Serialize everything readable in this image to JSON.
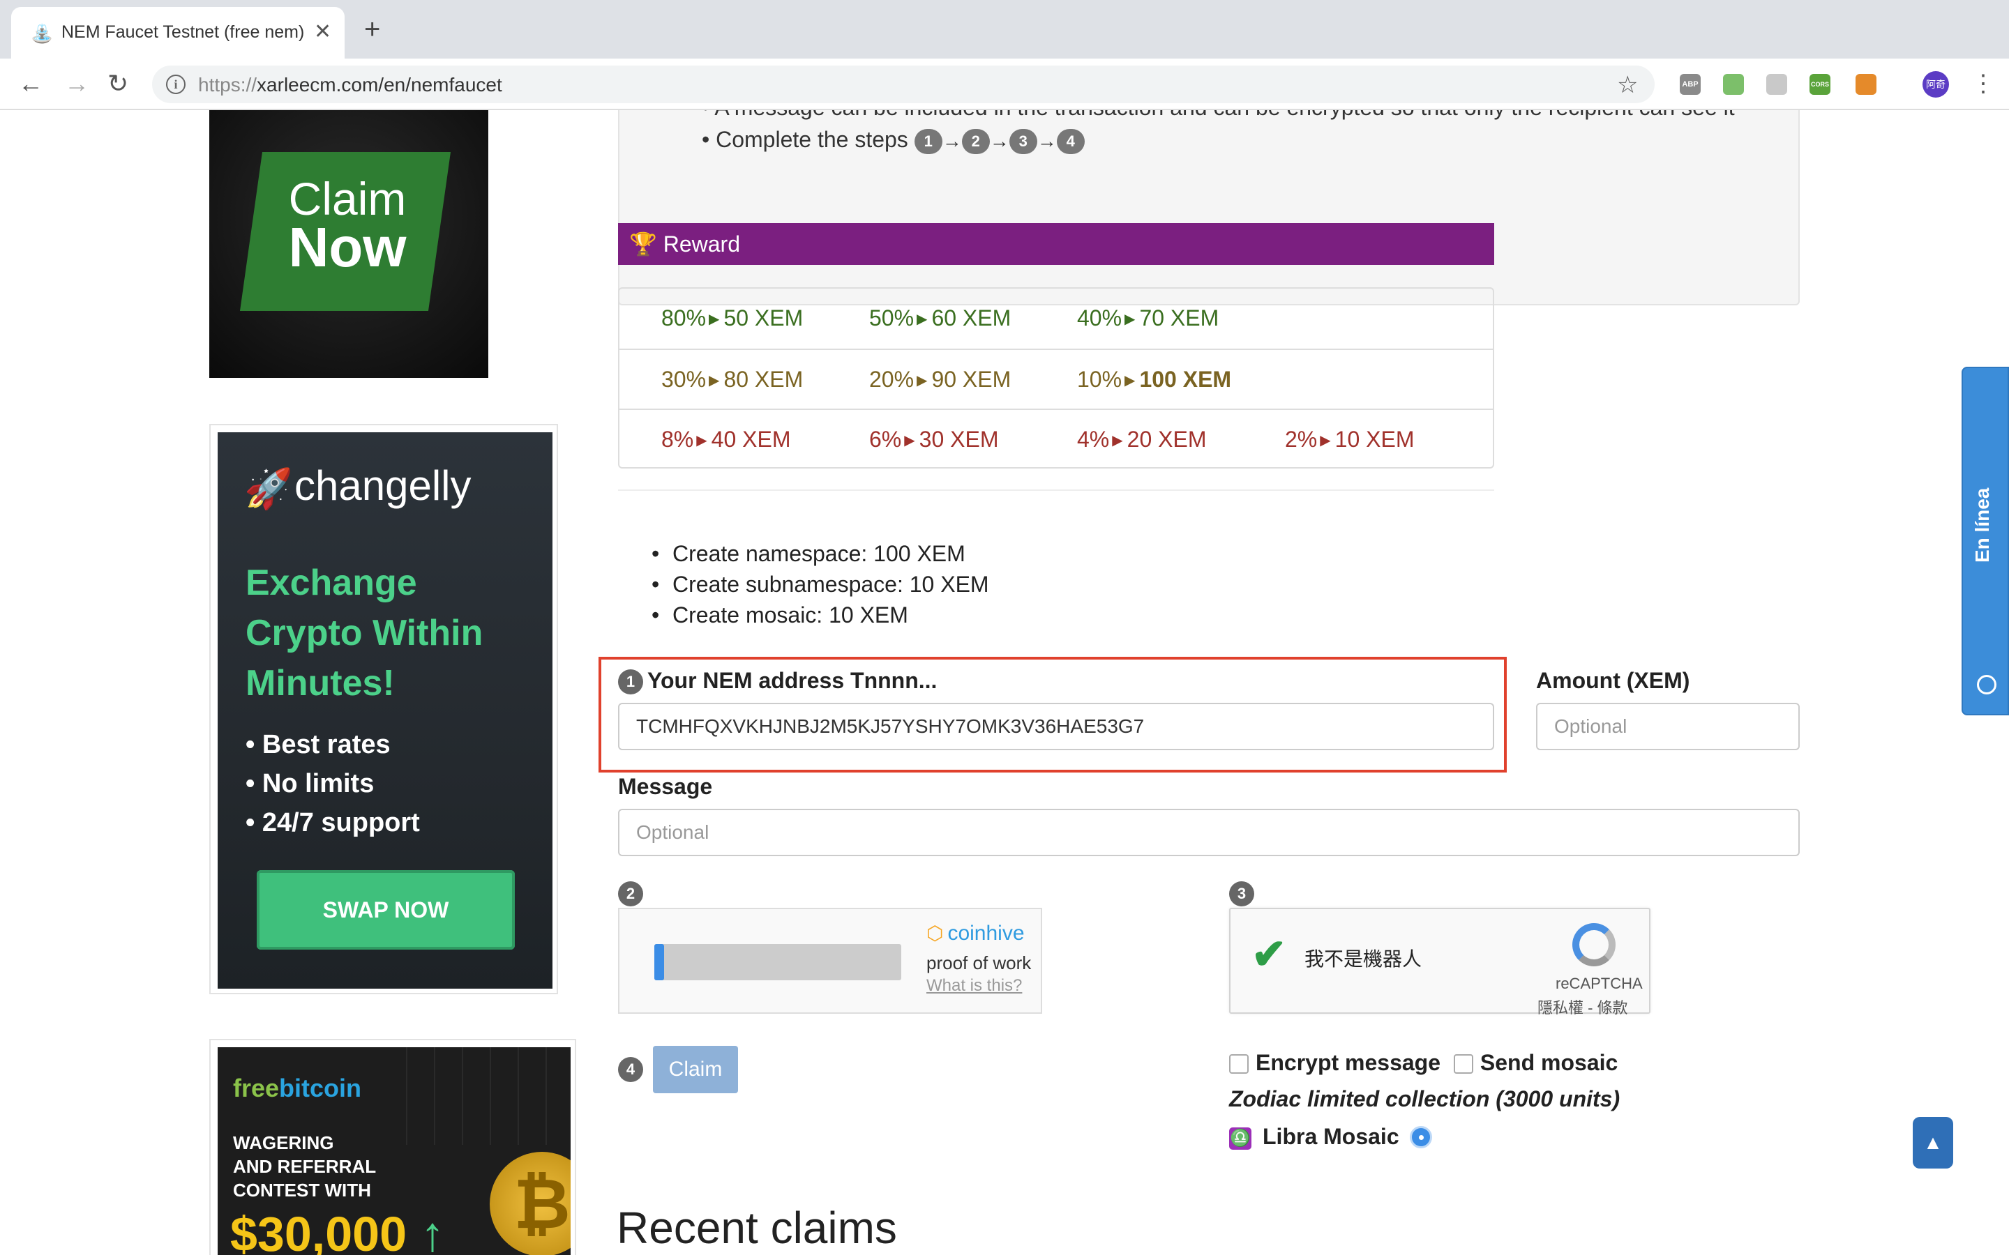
{
  "browser": {
    "tab_title": "NEM Faucet Testnet (free nem)",
    "url_protocol": "https://",
    "url_rest": "xarleecm.com/en/nemfaucet",
    "avatar_text": "阿奇",
    "extensions": [
      {
        "label": "ABP",
        "color": "#8a8a8a"
      },
      {
        "label": "",
        "color": "#7cbf6a"
      },
      {
        "label": "",
        "color": "#c9c9c9"
      },
      {
        "label": "CORS",
        "color": "#5aa33a"
      },
      {
        "label": "",
        "color": "#e58a2a"
      }
    ]
  },
  "ads": {
    "claim": {
      "line1": "Claim",
      "line2": "Now"
    },
    "changelly": {
      "logo": "changelly",
      "headline": [
        "Exchange",
        "Crypto Within",
        "Minutes!"
      ],
      "bullets": [
        "Best rates",
        "No limits",
        "24/7 support"
      ],
      "button": "SWAP NOW"
    },
    "freebitcoin": {
      "logo_a": "free",
      "logo_b": "bitcoin",
      "text": [
        "WAGERING",
        "AND REFERRAL",
        "CONTEST WITH"
      ],
      "amount": "$30,000"
    }
  },
  "info": {
    "cut_line": "A message can be included in the transaction and can be encrypted so that only the recipient can see it",
    "steps_label": "Complete the steps",
    "steps": [
      "1",
      "2",
      "3",
      "4"
    ]
  },
  "reward": {
    "title": "Reward",
    "rows": [
      [
        {
          "pct": "80%",
          "amt": "50 XEM",
          "tone": "green"
        },
        {
          "pct": "50%",
          "amt": "60 XEM",
          "tone": "green"
        },
        {
          "pct": "40%",
          "amt": "70 XEM",
          "tone": "green"
        }
      ],
      [
        {
          "pct": "30%",
          "amt": "80 XEM",
          "tone": "olive"
        },
        {
          "pct": "20%",
          "amt": "90 XEM",
          "tone": "olive"
        },
        {
          "pct": "10%",
          "amt": "100 XEM",
          "tone": "olive",
          "bold": true
        }
      ],
      [
        {
          "pct": "8%",
          "amt": "40 XEM",
          "tone": "red"
        },
        {
          "pct": "6%",
          "amt": "30 XEM",
          "tone": "red"
        },
        {
          "pct": "4%",
          "amt": "20 XEM",
          "tone": "red"
        },
        {
          "pct": "2%",
          "amt": "10 XEM",
          "tone": "red"
        }
      ]
    ]
  },
  "costs": [
    "Create namespace: 100 XEM",
    "Create subnamespace: 10 XEM",
    "Create mosaic: 10 XEM"
  ],
  "form": {
    "address_step": "1",
    "address_label": "Your NEM address Tnnnn...",
    "address_value": "TCMHFQXVKHJNBJ2M5KJ57YSHY7OMK3V36HAE53G7",
    "amount_label": "Amount (XEM)",
    "amount_placeholder": "Optional",
    "message_label": "Message",
    "message_placeholder": "Optional",
    "pow_step": "2",
    "captcha_step": "3",
    "claim_step": "4",
    "claim_button": "Claim",
    "encrypt_label": "Encrypt message",
    "send_mosaic_label": "Send mosaic",
    "zodiac_text": "Zodiac limited collection (3000 units)",
    "libra_icon": "♎",
    "libra_label": "Libra Mosaic"
  },
  "coinhive": {
    "brand": "coinhive",
    "subtitle": "proof of work",
    "link": "What is this?",
    "progress": 0.02
  },
  "recaptcha": {
    "text": "我不是機器人",
    "brand": "reCAPTCHA",
    "links": "隱私權 - 條款"
  },
  "recent_title": "Recent claims",
  "side_tab": {
    "label": "En línea"
  },
  "colors": {
    "reward_header": "#7b1f80",
    "highlight_border": "#e0412d",
    "claim_button": "#8eb1d8",
    "side_tab": "#3c8dd9"
  }
}
